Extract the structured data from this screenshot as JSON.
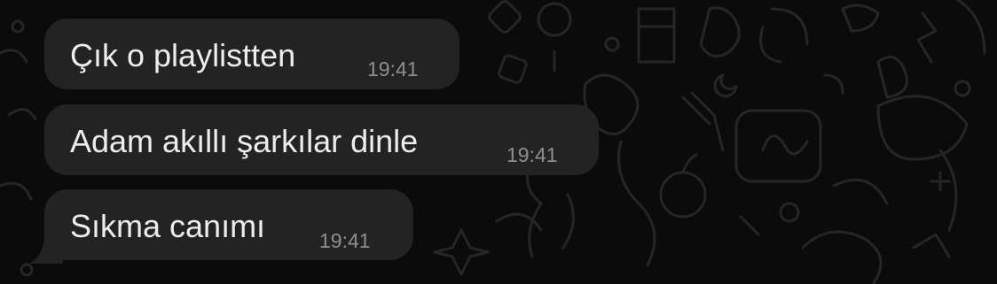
{
  "wallpaper": {
    "style": "doodle-pattern-dark",
    "background_color": "#0b0b0b",
    "doodle_color": "#262626"
  },
  "bubble_color": "#232323",
  "messages": [
    {
      "text": "Çık o playlistten",
      "time": "19:41"
    },
    {
      "text": "Adam akıllı şarkılar dinle",
      "time": "19:41"
    },
    {
      "text": "Sıkma canımı",
      "time": "19:41"
    }
  ]
}
